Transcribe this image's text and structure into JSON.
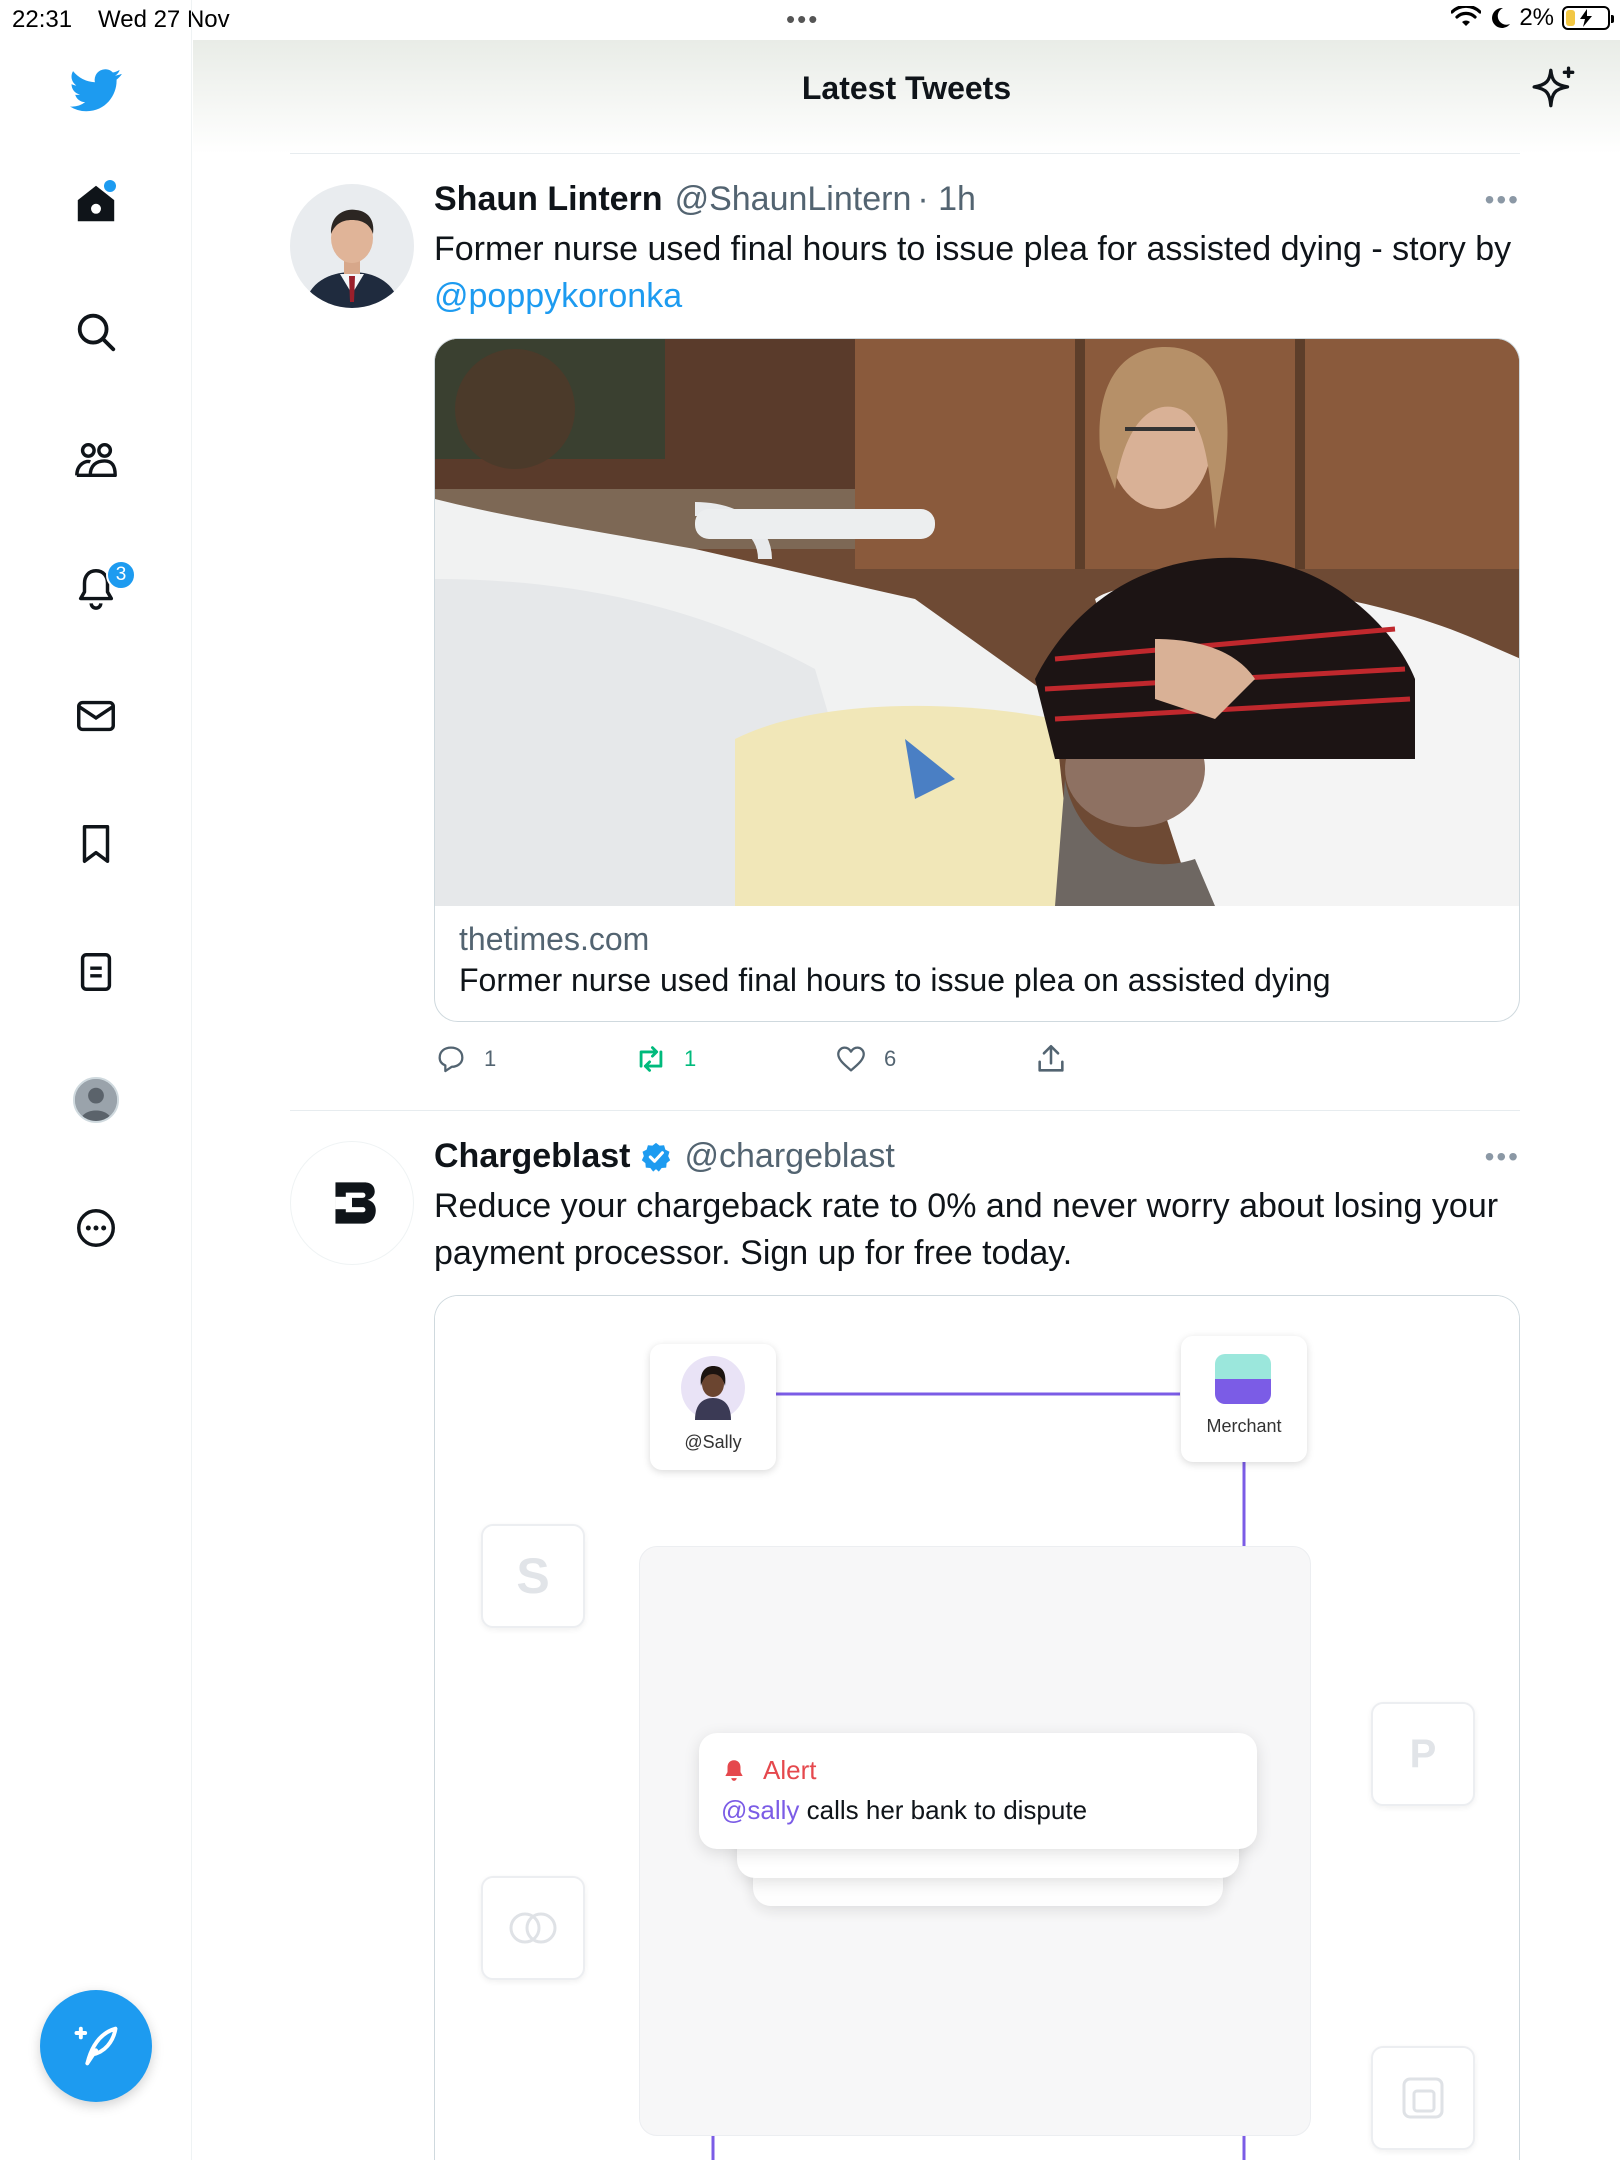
{
  "status_bar": {
    "time": "22:31",
    "date": "Wed 27 Nov",
    "battery": "2%"
  },
  "header": {
    "title": "Latest Tweets"
  },
  "sidebar": {
    "notifications_badge": "3"
  },
  "tweets": [
    {
      "name": "Shaun Lintern",
      "handle": "@ShaunLintern",
      "time": "· 1h",
      "text": "Former nurse used final hours to issue plea for assisted dying - story by",
      "mention": "@poppykoronka",
      "card": {
        "domain": "thetimes.com",
        "title": "Former nurse used final hours to issue plea on assisted dying"
      },
      "actions": {
        "replies": "1",
        "retweets": "1",
        "likes": "6"
      }
    },
    {
      "name": "Chargeblast",
      "handle": "@chargeblast",
      "text": "Reduce your chargeback rate to 0% and never worry about losing your payment processor. Sign up for free today.",
      "ad": {
        "user_label": "@Sally",
        "merchant_label": "Merchant",
        "alert_title": "Alert",
        "alert_mention": "@sally",
        "alert_text": "calls her bank to dispute"
      }
    }
  ],
  "colors": {
    "accent": "#1d9bf0",
    "retweet_green": "#00ba7c",
    "ad_purple": "#7b5ce6",
    "alert_red": "#e5484d"
  }
}
